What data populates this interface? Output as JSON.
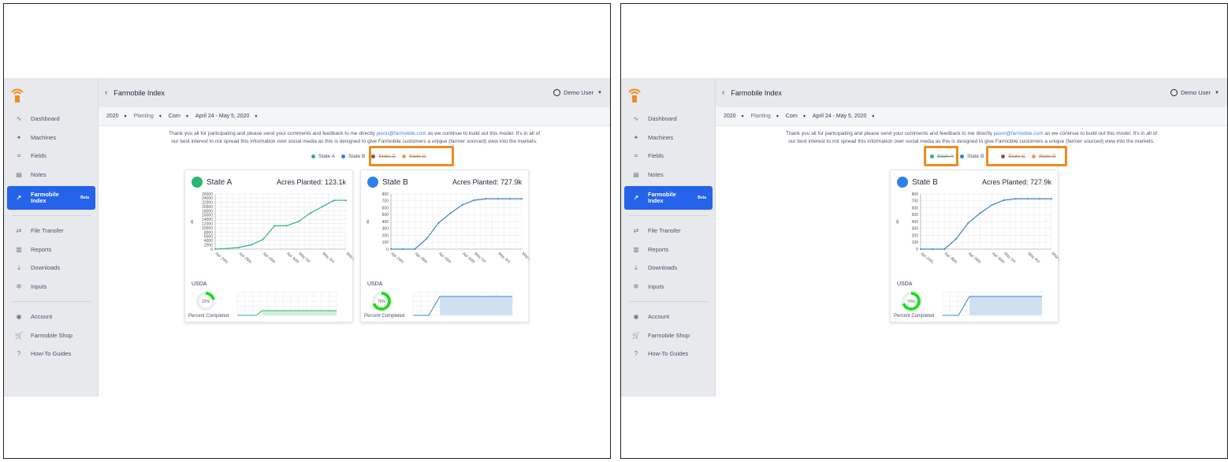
{
  "app": {
    "title": "Farmobile Index",
    "back_icon": "chevron-left-icon",
    "user_label": "Demo User"
  },
  "sidebar": {
    "items": [
      {
        "label": "Dashboard",
        "icon": "∿"
      },
      {
        "label": "Machines",
        "icon": "✦"
      },
      {
        "label": "Fields",
        "icon": "⌗"
      },
      {
        "label": "Notes",
        "icon": "▤"
      },
      {
        "label": "Farmobile Index",
        "icon": "↗",
        "badge": "Beta",
        "active": true
      },
      {
        "label": "File Transfer",
        "icon": "⇄"
      },
      {
        "label": "Reports",
        "icon": "▥"
      },
      {
        "label": "Downloads",
        "icon": "⤓"
      },
      {
        "label": "Inputs",
        "icon": "✲"
      },
      {
        "label": "Account",
        "icon": "◉"
      },
      {
        "label": "Farmobile Shop",
        "icon": "🛒"
      },
      {
        "label": "How-To Guides",
        "icon": "?"
      }
    ]
  },
  "filters": {
    "year": "2020",
    "activity": "Planting",
    "crop": "Corn",
    "range": "April 24 - May 5, 2020"
  },
  "notice": {
    "line1_a": "Thank you all for participating and please send your comments and feedback to me directly ",
    "email": "jason@farmobile.com",
    "line1_b": " as we continue to build out this model. It's in all of",
    "line2": "our best interest to not spread this information over social media as this is designed to give Farmobile customers a unique (farmer sourced) view into the markets."
  },
  "legend": [
    {
      "label": "State A",
      "color": "#2bb673"
    },
    {
      "label": "State B",
      "color": "#2f80ed"
    },
    {
      "label": "State C",
      "color": "#8c5a3c"
    },
    {
      "label": "State D",
      "color": "#e9a25f"
    }
  ],
  "colors": {
    "accent": "#2563eb",
    "highlight": "#f08b1e",
    "green": "#2bb673",
    "blue": "#3b82c4"
  },
  "cards": {
    "a": {
      "name": "State A",
      "acres": "Acres Planted: 123.1k",
      "usda": "USDA",
      "pct": "22%",
      "pct_label": "Percent Completed"
    },
    "b": {
      "name": "State B",
      "acres": "Acres Planted: 727.9k",
      "usda": "USDA",
      "pct": "70%",
      "pct_label": "Percent Completed"
    }
  },
  "chart_data": [
    {
      "type": "line",
      "title": "State A",
      "ylabel": "ac",
      "x": [
        "Apr 24th",
        "Apr 25th",
        "Apr 26th",
        "Apr 27th",
        "Apr 28th",
        "Apr 29th",
        "Apr 30th",
        "May 1st",
        "May 2nd",
        "May 3rd",
        "May 4th",
        "May 5th"
      ],
      "xticks": [
        "Apr 24th",
        "Apr 26th",
        "Apr 28th",
        "Apr 30th",
        "May 1st",
        "May 3rd",
        "May 5th"
      ],
      "yticks": [
        0,
        2000,
        4000,
        6000,
        8000,
        10000,
        12000,
        14000,
        16000,
        18000,
        20000,
        22000,
        24000,
        26000
      ],
      "ylim": [
        0,
        26000
      ],
      "series": [
        {
          "values": [
            0,
            300,
            800,
            2000,
            4500,
            11000,
            11000,
            13000,
            17000,
            20000,
            23000,
            23000
          ]
        }
      ]
    },
    {
      "type": "line",
      "title": "State B",
      "ylabel": "ac",
      "x": [
        "Apr 24th",
        "Apr 25th",
        "Apr 26th",
        "Apr 27th",
        "Apr 28th",
        "Apr 29th",
        "Apr 30th",
        "May 1st",
        "May 2nd",
        "May 3rd",
        "May 4th",
        "May 5th"
      ],
      "xticks": [
        "Apr 24th",
        "Apr 26th",
        "Apr 28th",
        "Apr 30th",
        "May 1st",
        "May 3rd",
        "May 5th"
      ],
      "yticks": [
        0,
        100,
        200,
        300,
        400,
        500,
        600,
        700,
        800
      ],
      "ylim": [
        0,
        800
      ],
      "series": [
        {
          "values": [
            0,
            0,
            0,
            150,
            380,
            520,
            640,
            710,
            730,
            730,
            730,
            730
          ]
        }
      ]
    }
  ]
}
